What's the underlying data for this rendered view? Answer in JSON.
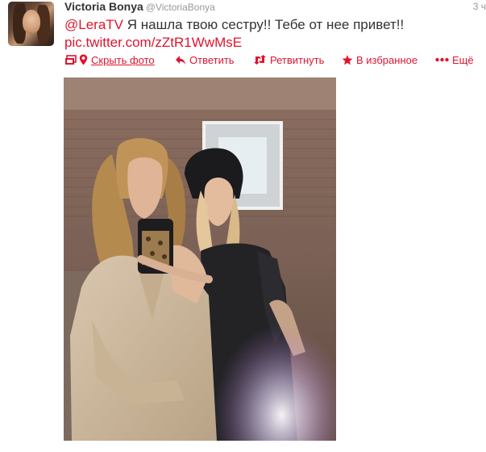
{
  "tweet": {
    "fullname": "Victoria Bonya",
    "username": "@VictoriaBonya",
    "time": "3 ч",
    "mention": "@LeraTV",
    "text": " Я нашла твою сестру!! Тебе от нее привет!!",
    "link": "pic.twitter.com/zZtR1WwMsE"
  },
  "actions": {
    "hide_photo": "Скрыть фото",
    "reply": "Ответить",
    "retweet": "Ретвитнуть",
    "favorite": "В избранное",
    "more": "Ещё"
  },
  "colors": {
    "accent": "#e0142e",
    "text": "#333333",
    "muted": "#999999"
  },
  "icons": [
    "photo-icon",
    "location-pin-icon",
    "reply-icon",
    "retweet-icon",
    "star-icon",
    "more-dots-icon"
  ]
}
